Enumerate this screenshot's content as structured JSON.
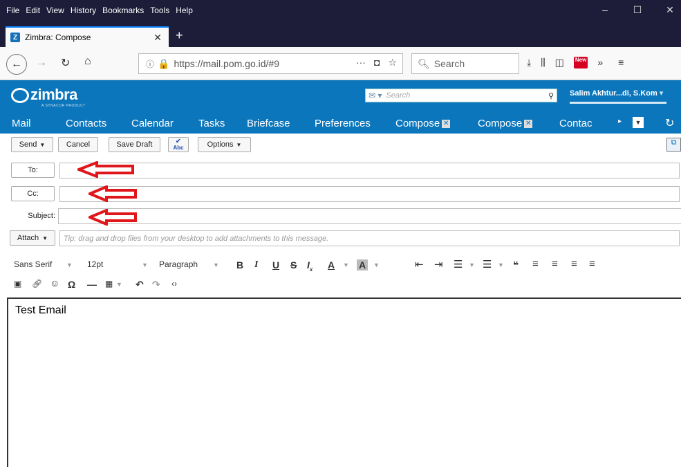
{
  "firefox": {
    "menu": [
      "File",
      "Edit",
      "View",
      "History",
      "Bookmarks",
      "Tools",
      "Help"
    ],
    "tab_title": "Zimbra: Compose",
    "tab_favicon_letter": "Z",
    "url": "https://mail.pom.go.id/#9",
    "url_host": "pom.go.id",
    "search_placeholder": "Search",
    "new_badge": "New"
  },
  "zimbra": {
    "logo": "zimbra",
    "logo_sub": "A SYNACOR PRODUCT",
    "search_placeholder": "Search",
    "user": "Salim Akhtur...di, S.Kom",
    "apps": [
      "Mail",
      "Contacts",
      "Calendar",
      "Tasks",
      "Briefcase",
      "Preferences",
      "Compose",
      "Compose",
      "Contac"
    ]
  },
  "toolbar": {
    "send": "Send",
    "cancel": "Cancel",
    "save_draft": "Save Draft",
    "spell": "Abc",
    "options": "Options"
  },
  "fields": {
    "to": "To:",
    "cc": "Cc:",
    "subject": "Subject:",
    "attach": "Attach",
    "tip": "Tip: drag and drop files from your desktop to add attachments to this message."
  },
  "editor_toolbar": {
    "font": "Sans Serif",
    "size": "12pt",
    "format": "Paragraph"
  },
  "body_text": "Test Email",
  "colors": {
    "zimbra_blue": "#0b76bc",
    "firefox_dark": "#1d1d3a",
    "arrow_red": "#e0161b"
  }
}
